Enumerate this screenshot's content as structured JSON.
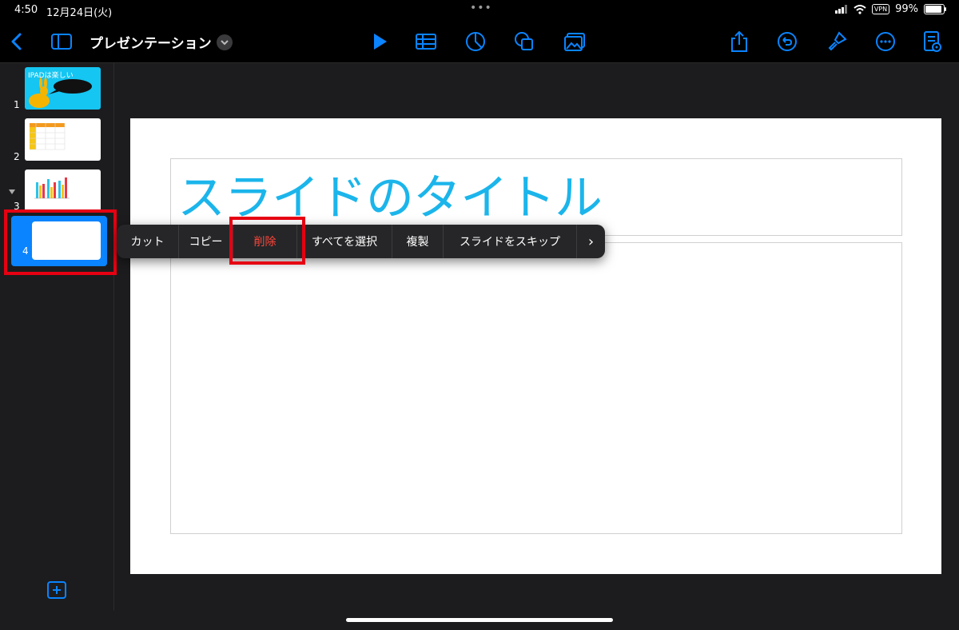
{
  "status": {
    "time": "4:50",
    "date": "12月24日(火)",
    "vpn": "VPN",
    "battery": "99%"
  },
  "toolbar": {
    "title": "プレゼンテーション",
    "accent": "#0a84ff",
    "left_icons": [
      "back-chevron-icon",
      "sidebar-icon"
    ],
    "center_icons": [
      "play-icon",
      "table-icon",
      "chart-icon",
      "shape-icon",
      "media-icon"
    ],
    "right_icons": [
      "share-icon",
      "undo-icon",
      "format-brush-icon",
      "more-icon",
      "document-view-icon"
    ]
  },
  "slides": [
    {
      "number": "1",
      "title": "IPADは楽しい"
    },
    {
      "number": "2"
    },
    {
      "number": "3"
    },
    {
      "number": "4"
    }
  ],
  "slide": {
    "title": "スライドのタイトル",
    "title_color": "#1bb5eb"
  },
  "context_menu": {
    "items": [
      {
        "label": "カット"
      },
      {
        "label": "コピー"
      },
      {
        "label": "削除"
      },
      {
        "label": "すべてを選択"
      },
      {
        "label": "複製"
      },
      {
        "label": "スライドをスキップ"
      }
    ],
    "more": "›"
  }
}
